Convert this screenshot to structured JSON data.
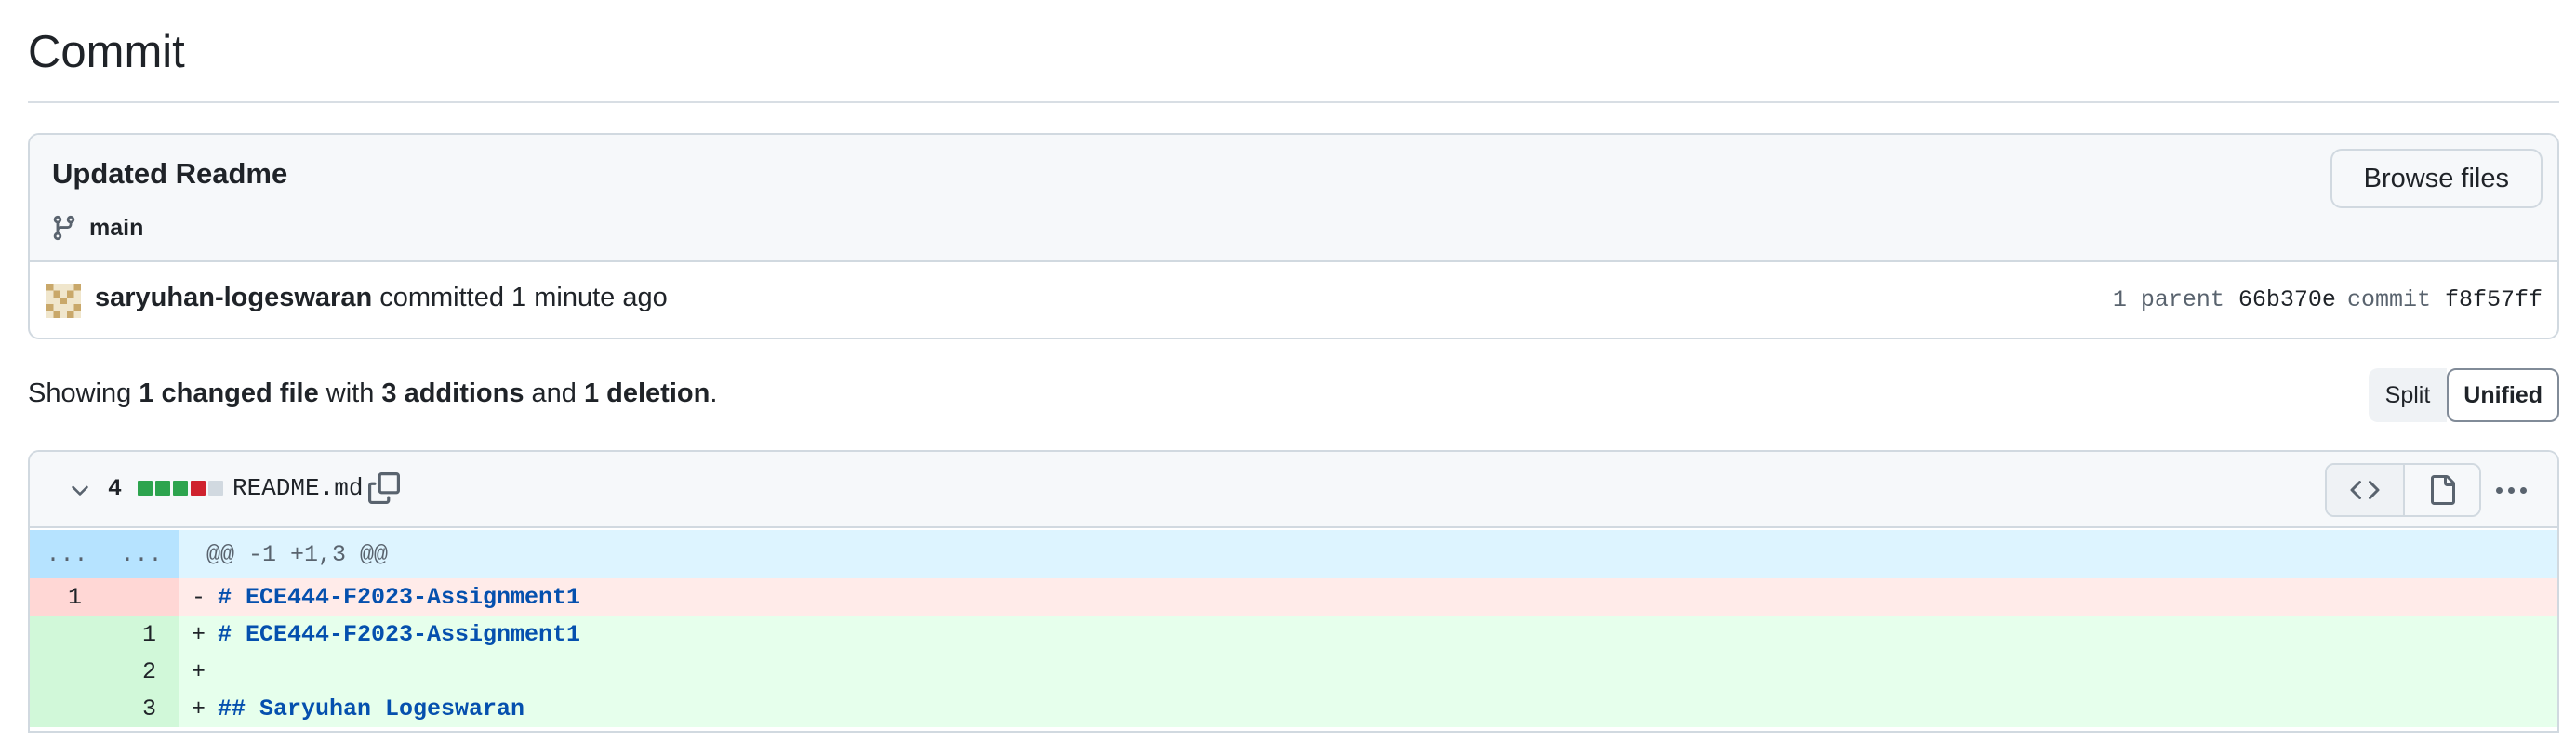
{
  "page": {
    "title": "Commit"
  },
  "commit": {
    "message": "Updated Readme",
    "branch": "main",
    "browse_label": "Browse files",
    "author": "saryuhan-logeswaran",
    "action_text": " committed 1 minute ago",
    "parent_label": "1 parent",
    "parent_sha": "66b370e",
    "commit_label": "commit",
    "commit_sha": "f8f57ff"
  },
  "summary": {
    "prefix": "Showing ",
    "changed": "1 changed file",
    "with": " with ",
    "additions": "3 additions",
    "and": " and ",
    "deletions": "1 deletion",
    "suffix": "."
  },
  "view_toggle": {
    "split": "Split",
    "unified": "Unified",
    "selected": "Unified"
  },
  "file": {
    "change_count": "4",
    "filename": "README.md",
    "diffstat_colors": [
      "#2da44e",
      "#2da44e",
      "#2da44e",
      "#cf222e",
      "#d1d9e0"
    ],
    "hunk": {
      "old_marker": "...",
      "new_marker": "...",
      "header": "@@ -1 +1,3 @@"
    },
    "lines": [
      {
        "type": "del",
        "old": "1",
        "new": "",
        "marker": "-",
        "text": "# ECE444-F2023-Assignment1"
      },
      {
        "type": "add",
        "old": "",
        "new": "1",
        "marker": "+",
        "text": "# ECE444-F2023-Assignment1"
      },
      {
        "type": "add",
        "old": "",
        "new": "2",
        "marker": "+",
        "text": ""
      },
      {
        "type": "add",
        "old": "",
        "new": "3",
        "marker": "+",
        "text": "## Saryuhan Logeswaran"
      }
    ]
  },
  "icons": [
    "git-branch-icon",
    "avatar-identicon",
    "chevron-down-icon",
    "copy-icon",
    "code-icon",
    "file-icon",
    "kebab-horizontal-icon"
  ],
  "colors": {
    "addition": "#2da44e",
    "deletion": "#cf222e",
    "hunk_bg": "#ddf4ff",
    "code_keyword": "#0550ae"
  }
}
